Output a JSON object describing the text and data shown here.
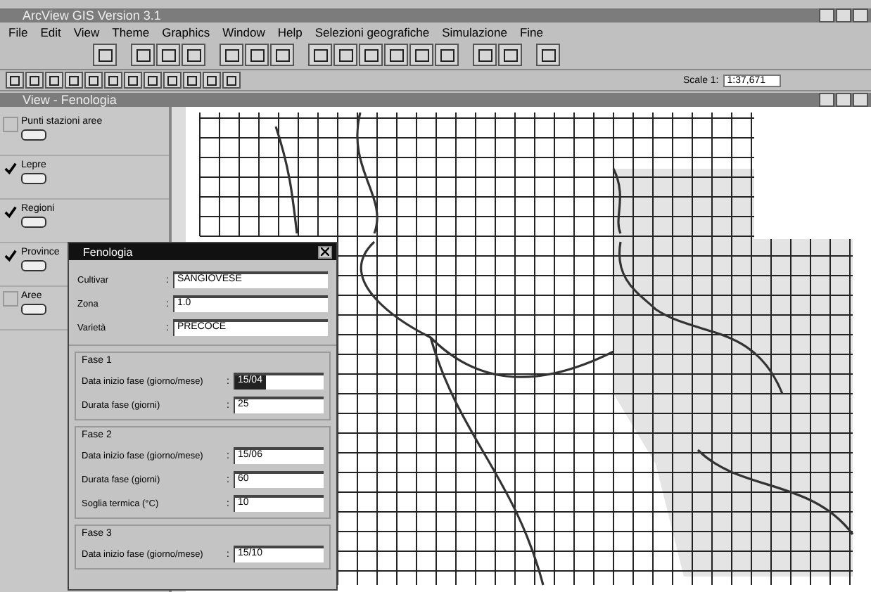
{
  "window": {
    "title": "ArcView GIS Version 3.1"
  },
  "menu": [
    "File",
    "Edit",
    "View",
    "Theme",
    "Graphics",
    "Window",
    "Help",
    "Selezioni geografiche",
    "Simulazione",
    "Fine"
  ],
  "scale": {
    "label": "Scale 1:",
    "value": "1:37,671"
  },
  "view": {
    "title": "View - Fenologia"
  },
  "legend": [
    {
      "name": "Punti stazioni aree",
      "checked": false
    },
    {
      "name": "Lepre",
      "checked": true
    },
    {
      "name": "Regioni",
      "checked": true
    },
    {
      "name": "Province",
      "checked": true
    },
    {
      "name": "Aree",
      "checked": false
    }
  ],
  "dialog": {
    "title": "Fenologia",
    "fields": [
      {
        "label": "Cultivar",
        "separator": ":",
        "value": "SANGIOVESE"
      },
      {
        "label": "Zona",
        "separator": ":",
        "value": "1.0"
      },
      {
        "label": "Varietà",
        "separator": ":",
        "value": "PRECOCE"
      }
    ],
    "phases": [
      {
        "title": "Fase 1",
        "fields": [
          {
            "label": "Data inizio fase (giorno/mese)",
            "separator": ":",
            "value": "15/04",
            "selected": true
          },
          {
            "label": "Durata fase (giorni)",
            "separator": ":",
            "value": "25",
            "selected": false
          }
        ]
      },
      {
        "title": "Fase 2",
        "fields": [
          {
            "label": "Data inizio fase (giorno/mese)",
            "separator": ":",
            "value": "15/06",
            "selected": false
          },
          {
            "label": "Durata fase (giorni)",
            "separator": ":",
            "value": "60",
            "selected": false
          },
          {
            "label": "Soglia termica (°C)",
            "separator": ":",
            "value": "10",
            "selected": false
          }
        ]
      },
      {
        "title": "Fase 3",
        "fields": [
          {
            "label": "Data inizio fase (giorno/mese)",
            "separator": ":",
            "value": "15/10",
            "selected": false
          }
        ]
      }
    ]
  }
}
